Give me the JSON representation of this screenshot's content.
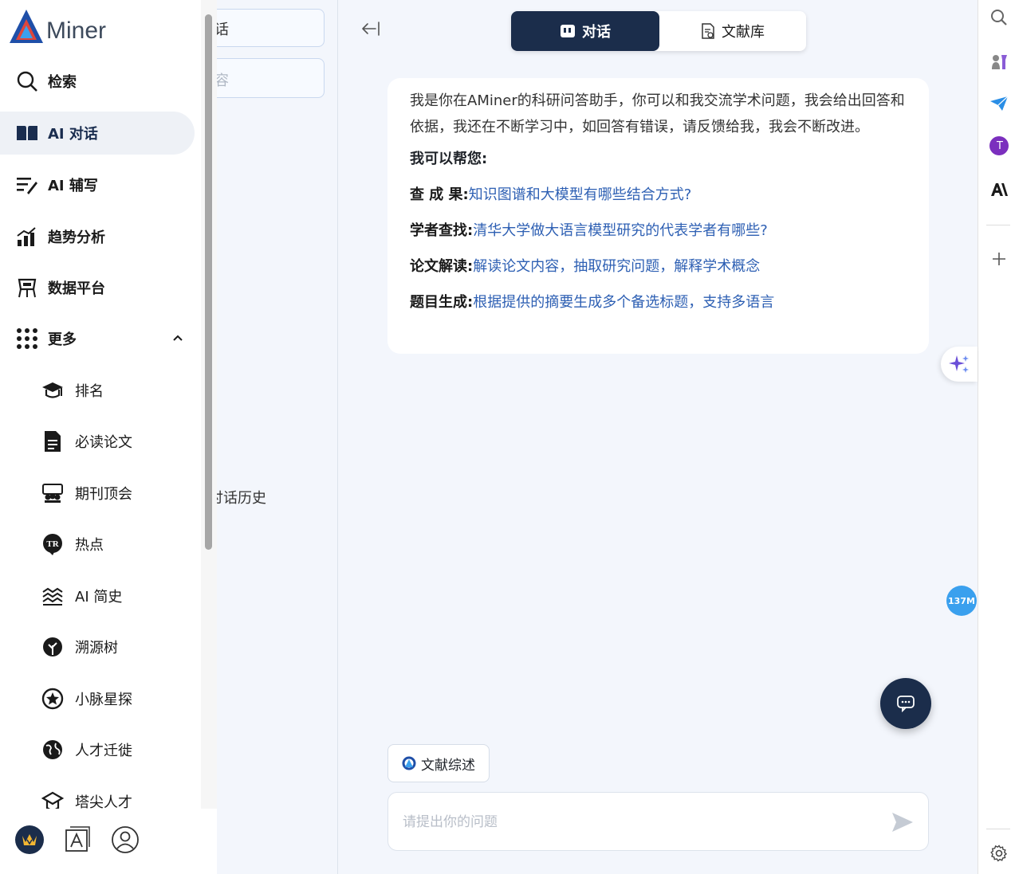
{
  "logo": {
    "text": "Miner"
  },
  "nav": {
    "items": [
      {
        "label": "检索",
        "icon": "search-icon"
      },
      {
        "label": "AI 对话",
        "icon": "book-open-icon",
        "active": true
      },
      {
        "label": "AI 辅写",
        "icon": "write-icon"
      },
      {
        "label": "趋势分析",
        "icon": "trend-chart-icon"
      },
      {
        "label": "数据平台",
        "icon": "data-platform-icon"
      },
      {
        "label": "更多",
        "icon": "grid-dots-icon",
        "expanded": true
      }
    ],
    "sub_items": [
      {
        "label": "排名",
        "icon": "graduation-cap-icon"
      },
      {
        "label": "必读论文",
        "icon": "document-icon"
      },
      {
        "label": "期刊顶会",
        "icon": "conference-icon"
      },
      {
        "label": "热点",
        "icon": "tr-badge-icon"
      },
      {
        "label": "AI 简史",
        "icon": "history-icon"
      },
      {
        "label": "溯源树",
        "icon": "tree-icon"
      },
      {
        "label": "小脉星探",
        "icon": "star-badge-icon"
      },
      {
        "label": "人才迁徙",
        "icon": "globe-icon"
      },
      {
        "label": "塔尖人才",
        "icon": "talent-icon"
      }
    ],
    "bottom_icons": [
      "crown-badge-icon",
      "letter-a-icon",
      "user-profile-icon"
    ]
  },
  "list_panel": {
    "box1_text": "话",
    "box2_text": "容",
    "history_text": "讨话历史"
  },
  "tabs": {
    "chat": "对话",
    "library": "文献库"
  },
  "message": {
    "intro": "我是你在AMiner的科研问答助手，你可以和我交流学术问题，我会给出回答和依据，我还在不断学习中，如回答有错误，请反馈给我，我会不断改进。",
    "help_title": "我可以帮您:",
    "rows": [
      {
        "key": "查 成 果:",
        "value": "知识图谱和大模型有哪些结合方式?"
      },
      {
        "key": "学者查找:",
        "value": "清华大学做大语言模型研究的代表学者有哪些?"
      },
      {
        "key": "论文解读:",
        "value": "解读论文内容，抽取研究问题，解释学术概念"
      },
      {
        "key": "题目生成:",
        "value": "根据提供的摘要生成多个备选标题，支持多语言"
      }
    ]
  },
  "chip": {
    "label": "文献综述"
  },
  "input": {
    "placeholder": "请提出你的问题",
    "value": ""
  },
  "memory_badge": "137M",
  "right_sidebar": {
    "avatar_letter": "T",
    "icons": [
      "search-icon",
      "chess-icon",
      "paper-plane-icon",
      "avatar-t-icon",
      "anthropic-icon",
      "plus-icon",
      "settings-icon"
    ]
  },
  "colors": {
    "navy": "#1b2d4b",
    "link": "#2d5fb3",
    "badge": "#3aa0ee",
    "purple": "#7b2fbe"
  }
}
